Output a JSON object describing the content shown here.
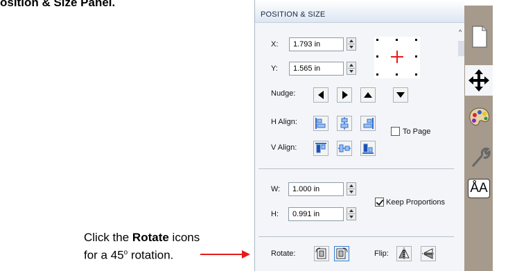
{
  "heading": "osition & Size Panel.",
  "caption": {
    "line1_pre": "Click the ",
    "line1_bold": "Rotate",
    "line1_post": " icons",
    "line2_pre": "for a 45",
    "line2_sup": "o",
    "line2_post": " rotation."
  },
  "panel": {
    "title": "POSITION & SIZE",
    "x_label": "X:",
    "x_value": "1.793 in",
    "y_label": "Y:",
    "y_value": "1.565 in",
    "nudge_label": "Nudge:",
    "h_align_label": "H Align:",
    "v_align_label": "V Align:",
    "to_page_label": "To Page",
    "to_page_checked": false,
    "w_label": "W:",
    "w_value": "1.000 in",
    "h_label": "H:",
    "h_value": "0.991 in",
    "keep_proportions_label": "Keep Proportions",
    "keep_proportions_checked": true,
    "rotate_label": "Rotate:",
    "flip_label": "Flip:"
  },
  "sidebar": {
    "tabs": [
      "document-tab",
      "position-size-tab",
      "color-palette-tab",
      "tools-tab",
      "text-tab"
    ],
    "text_tab_glyph": "ÅA"
  },
  "colors": {
    "arrow": "#e31b1b",
    "crosshair": "#e31b1b",
    "align_blue": "#2f6fd1",
    "tab_bar": "#a59a8c"
  }
}
